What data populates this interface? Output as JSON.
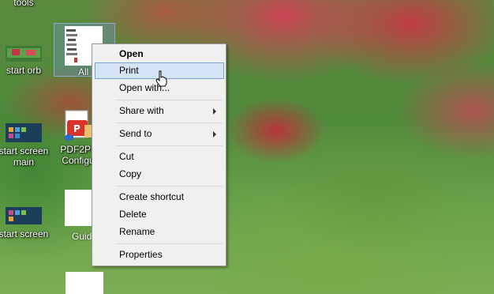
{
  "desktop": {
    "icons": [
      {
        "label": "tools"
      },
      {
        "label": "start orb"
      },
      {
        "label": "All"
      },
      {
        "label": "start screen main"
      },
      {
        "label": "PDF2Pri Configu"
      },
      {
        "label": "start screen"
      },
      {
        "label": "Guid"
      }
    ]
  },
  "context_menu": {
    "items": {
      "open": "Open",
      "print": "Print",
      "open_with": "Open with...",
      "share_with": "Share with",
      "send_to": "Send to",
      "cut": "Cut",
      "copy": "Copy",
      "create_shortcut": "Create shortcut",
      "delete": "Delete",
      "rename": "Rename",
      "properties": "Properties"
    },
    "hover_color": "#d5e4f4",
    "hover_border": "#7da2ce"
  }
}
